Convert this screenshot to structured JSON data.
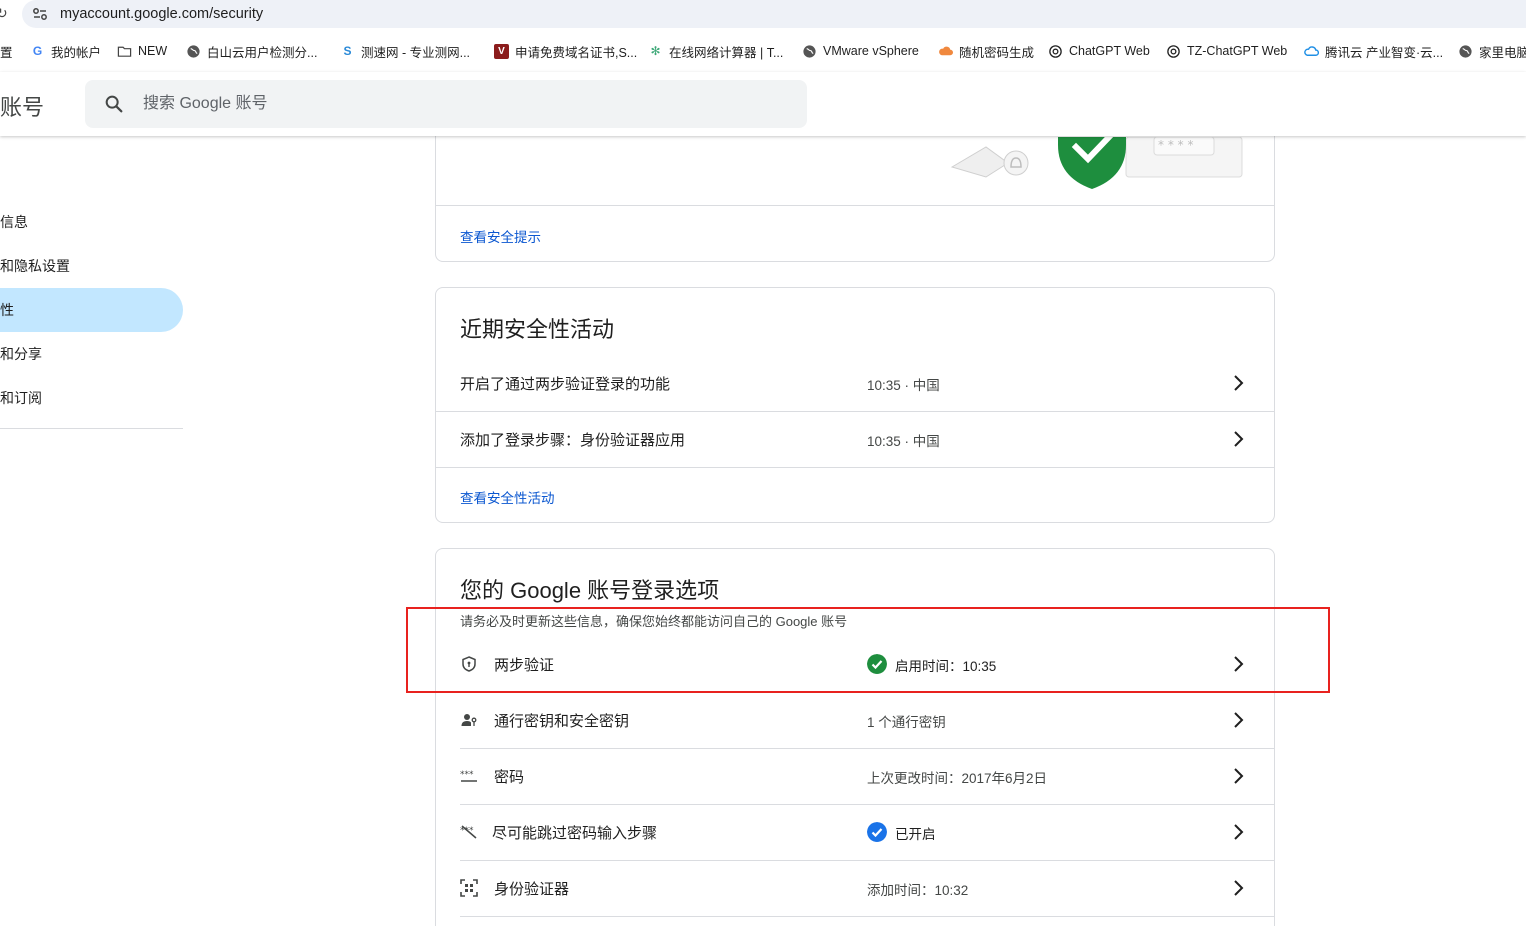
{
  "browser": {
    "url": "myaccount.google.com/security",
    "bookmarks": [
      {
        "label": "置",
        "icon": "none"
      },
      {
        "label": "我的帐户",
        "icon": "google-icon"
      },
      {
        "label": "NEW",
        "icon": "folder-icon"
      },
      {
        "label": "白山云用户检测分...",
        "icon": "globe-icon"
      },
      {
        "label": "测速网 - 专业测网...",
        "icon": "speedtest-icon"
      },
      {
        "label": "申请免费域名证书,S...",
        "icon": "shield-v-icon"
      },
      {
        "label": "在线网络计算器 | T...",
        "icon": "gear-icon"
      },
      {
        "label": "VMware vSphere",
        "icon": "globe-icon"
      },
      {
        "label": "随机密码生成",
        "icon": "cloud-icon"
      },
      {
        "label": "ChatGPT Web",
        "icon": "openai-icon"
      },
      {
        "label": "TZ-ChatGPT Web",
        "icon": "openai-icon"
      },
      {
        "label": "腾讯云 产业智变·云...",
        "icon": "tencent-cloud-icon"
      },
      {
        "label": "家里电脑",
        "icon": "globe-icon"
      }
    ]
  },
  "header": {
    "brand": "账号",
    "search_placeholder": "搜索 Google 账号"
  },
  "sidebar": {
    "items": [
      {
        "label": "信息",
        "active": false
      },
      {
        "label": "和隐私设置",
        "active": false
      },
      {
        "label": "性",
        "active": true
      },
      {
        "label": "和分享",
        "active": false
      },
      {
        "label": "和订阅",
        "active": false
      }
    ]
  },
  "security_tips": {
    "link": "查看安全提示",
    "stars": "* * * *"
  },
  "recent_activity": {
    "title": "近期安全性活动",
    "rows": [
      {
        "label": "开启了通过两步验证登录的功能",
        "value": "10:35 · 中国"
      },
      {
        "label": "添加了登录步骤：身份验证器应用",
        "value": "10:35 · 中国"
      }
    ],
    "link": "查看安全性活动"
  },
  "signin_options": {
    "title": "您的 Google 账号登录选项",
    "subtitle": "请务必及时更新这些信息，确保您始终都能访问自己的 Google 账号",
    "rows": [
      {
        "label": "两步验证",
        "value": "启用时间：10:35",
        "icon": "shield-outline-icon",
        "badge": "green-check"
      },
      {
        "label": "通行密钥和安全密钥",
        "value": "1 个通行密钥",
        "icon": "person-key-icon",
        "badge": ""
      },
      {
        "label": "密码",
        "value": "上次更改时间：2017年6月2日",
        "icon": "password-dots-icon",
        "badge": ""
      },
      {
        "label": "尽可能跳过密码输入步骤",
        "value": "已开启",
        "icon": "password-skip-icon",
        "badge": "blue-check"
      },
      {
        "label": "身份验证器",
        "value": "添加时间：10:32",
        "icon": "qr-scan-icon",
        "badge": ""
      }
    ]
  },
  "colors": {
    "accent": "#0b57d0",
    "active_nav": "#c2e7ff",
    "success": "#1e8e3e",
    "info": "#1a73e8",
    "highlight": "#e8221f"
  }
}
